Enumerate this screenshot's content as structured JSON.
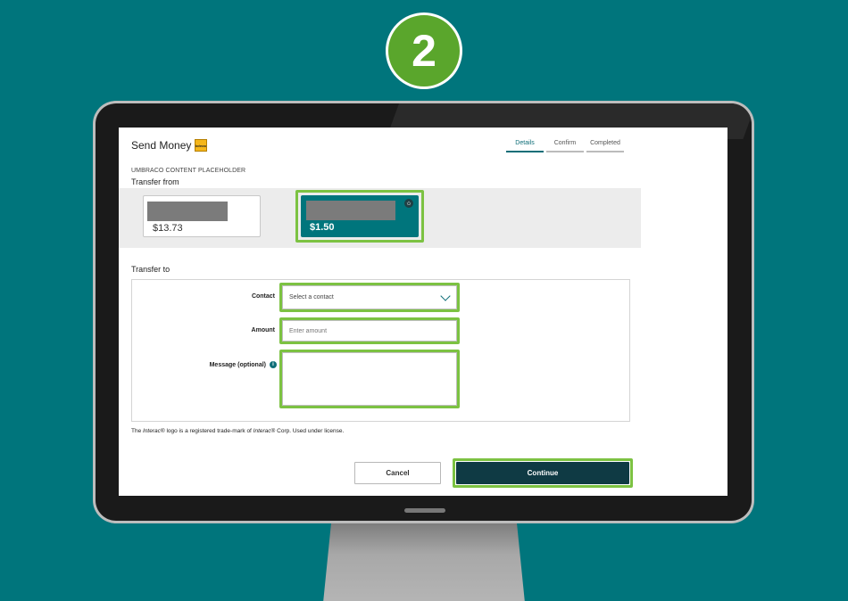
{
  "step_number": "2",
  "colors": {
    "background": "#00757c",
    "highlight": "#7cc242",
    "accent": "#0f6e78",
    "primary_button": "#0f3a44"
  },
  "header": {
    "title": "Send Money",
    "logo_icon": "interac-logo",
    "logo_text": "Interac"
  },
  "steps": [
    {
      "label": "Details",
      "active": true
    },
    {
      "label": "Confirm",
      "active": false
    },
    {
      "label": "Completed",
      "active": false
    }
  ],
  "content_placeholder": "UMBRACO CONTENT PLACEHOLDER",
  "transfer_from": {
    "label": "Transfer from",
    "accounts": [
      {
        "balance": "$13.73",
        "selected": false
      },
      {
        "balance": "$1.50",
        "selected": true,
        "icon": "star-icon"
      }
    ]
  },
  "transfer_to": {
    "label": "Transfer to",
    "contact": {
      "label": "Contact",
      "value": "Select a contact"
    },
    "amount": {
      "label": "Amount",
      "placeholder": "Enter amount"
    },
    "message": {
      "label": "Message (optional)",
      "info_icon": "i"
    }
  },
  "legal": {
    "prefix": "The ",
    "brand1": "Interac",
    "mid": "® logo is a registered trade-mark of ",
    "brand2": "Interac",
    "suffix": "® Corp. Used under license."
  },
  "buttons": {
    "cancel": "Cancel",
    "continue": "Continue"
  }
}
